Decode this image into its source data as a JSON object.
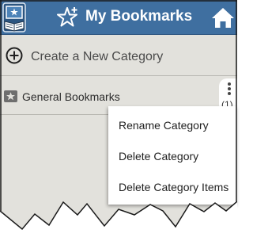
{
  "header": {
    "title": "My Bookmarks",
    "background_color": "#3f6fa0",
    "app_icon": "book-app-icon",
    "title_icon": "star-plus-icon",
    "home_icon": "home-icon"
  },
  "create_row": {
    "label": "Create a New Category",
    "icon": "plus-circle-icon"
  },
  "categories": [
    {
      "label": "General Bookmarks",
      "count": "(1)",
      "icon": "star-icon",
      "menu_icon": "kebab-menu-icon"
    }
  ],
  "context_menu": {
    "items": [
      "Rename Category",
      "Delete Category",
      "Delete Category Items"
    ]
  }
}
